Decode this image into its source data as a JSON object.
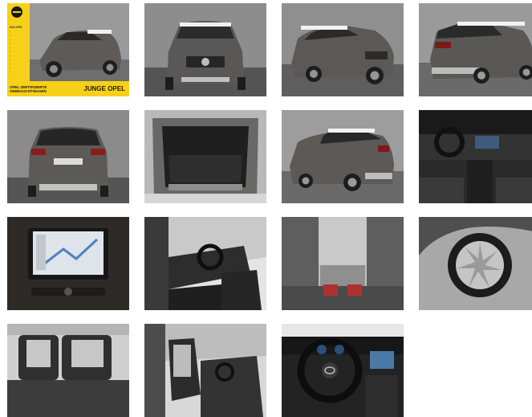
{
  "gallery": {
    "photos": [
      {
        "alt": "exterior-front-left-with-badge"
      },
      {
        "alt": "exterior-front"
      },
      {
        "alt": "exterior-front-right"
      },
      {
        "alt": "exterior-rear-right"
      },
      {
        "alt": "exterior-rear"
      },
      {
        "alt": "trunk-open"
      },
      {
        "alt": "exterior-rear-left"
      },
      {
        "alt": "dashboard-interior"
      },
      {
        "alt": "navigation-screen"
      },
      {
        "alt": "driver-seat-door-open"
      },
      {
        "alt": "rear-seat-isofix"
      },
      {
        "alt": "alloy-wheel"
      },
      {
        "alt": "rear-bench-seats"
      },
      {
        "alt": "front-seats-door-open"
      },
      {
        "alt": "steering-wheel-cockpit"
      }
    ],
    "badge": {
      "logo_caption": "DAS OPEL",
      "bottom_left_line1": "OPEL ZERTIFIZIERTE",
      "bottom_left_line2": "GEBRAUCHTWAGEN",
      "bottom_right": "JUNGE OPEL"
    }
  }
}
